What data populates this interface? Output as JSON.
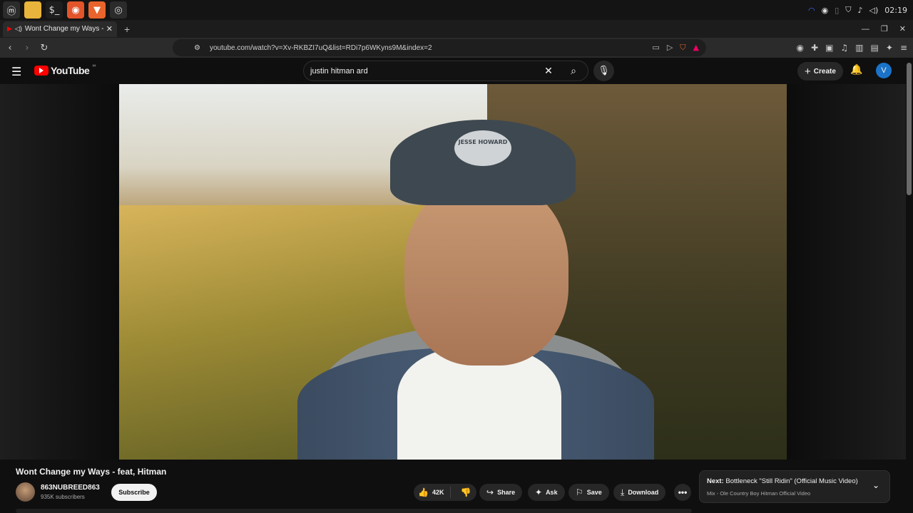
{
  "taskbar": {
    "apps": [
      {
        "name": "mint-menu-icon",
        "glyph": "ⓜ",
        "bg": "#2b2b2b",
        "color": "#ffffff"
      },
      {
        "name": "files-icon",
        "glyph": "▬",
        "bg": "#e9b43b",
        "color": "#e9b43b"
      },
      {
        "name": "terminal-icon",
        "glyph": "$_",
        "bg": "#1e1e1e",
        "color": "#dddddd"
      },
      {
        "name": "firefox-icon",
        "glyph": "◉",
        "bg": "#e2552b",
        "color": "#ffffff"
      },
      {
        "name": "brave-icon",
        "glyph": "▼",
        "bg": "#e8642c",
        "color": "#ffffff"
      },
      {
        "name": "chromium-icon",
        "glyph": "◎",
        "bg": "#2b2b2b",
        "color": "#dddddd"
      }
    ],
    "clock": "02:19"
  },
  "browser": {
    "tab_title": "Wont Change my Ways - fe",
    "url": "youtube.com/watch?v=Xv-RKBZI7uQ&list=RDi7p6WKyns9M&index=2"
  },
  "youtube": {
    "logo_text": "YouTube",
    "logo_sup": "∞",
    "search_query": "justin hitman ard",
    "create_label": "Create",
    "avatar_letter": "V",
    "cap_text": "JESSE HOWARD"
  },
  "video": {
    "title": "Wont Change my Ways - feat, Hitman",
    "channel": "863NUBREED863",
    "subscribers": "935K subscribers",
    "subscribe_label": "Subscribe",
    "likes": "42K",
    "share_label": "Share",
    "ask_label": "Ask",
    "save_label": "Save",
    "download_label": "Download"
  },
  "up_next": {
    "prefix": "Next:",
    "title": "Bottleneck \"Still Ridin\" (Official Music Video)",
    "subtitle": "Mix - Ole Country Boy Hitman Official Video"
  },
  "colors": {
    "accent_red": "#ff0000",
    "background": "#0f0f0f"
  }
}
